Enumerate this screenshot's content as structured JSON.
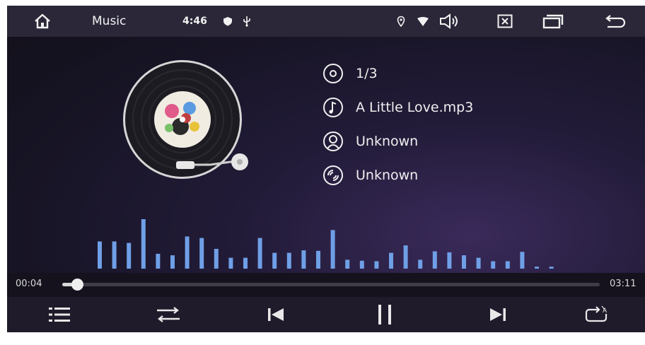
{
  "status_bar": {
    "app_title": "Music",
    "clock": "4:46",
    "icons": [
      "home-icon",
      "shield-dot-icon",
      "usb-icon",
      "location-icon",
      "wifi-icon",
      "volume-icon",
      "close-box-icon",
      "recent-apps-icon",
      "back-icon"
    ]
  },
  "track_info": {
    "track_number": "1/3",
    "title": "A Little Love.mp3",
    "artist": "Unknown",
    "album": "Unknown",
    "icons": [
      "disc-icon",
      "music-note-icon",
      "person-icon",
      "album-icon"
    ]
  },
  "equalizer": {
    "bar_color": "#6f9fe6",
    "levels": [
      0.55,
      0.55,
      0.52,
      1.0,
      0.3,
      0.27,
      0.65,
      0.62,
      0.4,
      0.22,
      0.22,
      0.62,
      0.32,
      0.32,
      0.37,
      0.36,
      0.78,
      0.18,
      0.16,
      0.15,
      0.32,
      0.47,
      0.18,
      0.35,
      0.33,
      0.27,
      0.22,
      0.15,
      0.15,
      0.34,
      0.04,
      0.04
    ]
  },
  "progress": {
    "elapsed": "00:04",
    "duration": "03:11",
    "fraction": 0.021
  },
  "controls": {
    "icons": [
      "playlist-icon",
      "shuffle-icon",
      "previous-icon",
      "pause-icon",
      "next-icon",
      "repeat-all-icon"
    ]
  },
  "colors": {
    "background": "#171425",
    "status_bar": "#2b2738",
    "controls_bar": "#1f1b2a",
    "text": "#f0f0f0"
  }
}
